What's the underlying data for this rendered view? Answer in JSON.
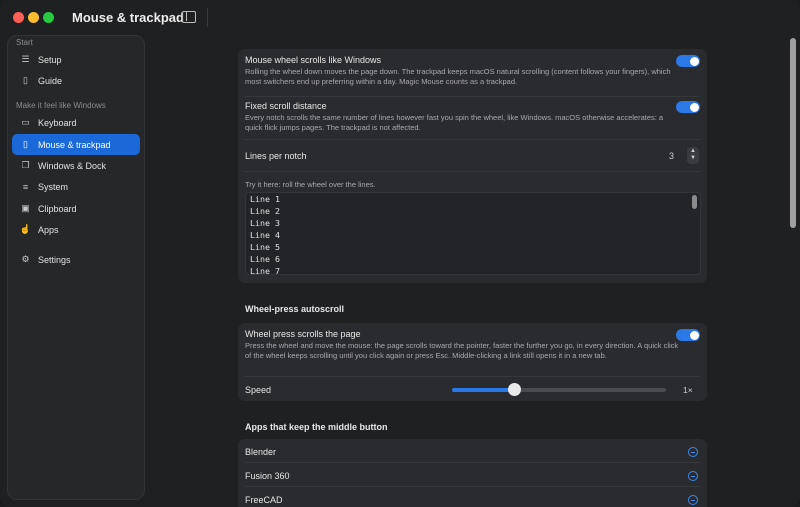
{
  "window": {
    "title": "Mouse & trackpad"
  },
  "sidebar": {
    "sections": [
      "Start",
      "Make it feel like Windows"
    ],
    "items": [
      {
        "label": "Setup",
        "icon": "checklist-icon"
      },
      {
        "label": "Guide",
        "icon": "book-icon"
      },
      {
        "label": "Keyboard",
        "icon": "keyboard-icon"
      },
      {
        "label": "Mouse & trackpad",
        "icon": "mouse-icon",
        "active": true
      },
      {
        "label": "Windows & Dock",
        "icon": "windows-icon"
      },
      {
        "label": "System",
        "icon": "sliders-icon"
      },
      {
        "label": "Clipboard",
        "icon": "clipboard-icon"
      },
      {
        "label": "Apps",
        "icon": "hand-icon"
      },
      {
        "label": "Settings",
        "icon": "gear-icon"
      }
    ]
  },
  "scroll": {
    "wheel_title": "Mouse wheel scrolls like Windows",
    "wheel_desc": "Rolling the wheel down moves the page down. The trackpad keeps macOS natural scrolling (content follows your fingers), which most switchers end up preferring within a day. Magic Mouse counts as a trackpad.",
    "wheel_on": true,
    "fixed_title": "Fixed scroll distance",
    "fixed_desc": "Every notch scrolls the same number of lines however fast you spin the wheel, like Windows. macOS otherwise accelerates: a quick flick jumps pages. The trackpad is not affected.",
    "fixed_on": true,
    "lines_label": "Lines per notch",
    "lines_value": "3",
    "try_hint": "Try it here: roll the wheel over the lines.",
    "test_lines": [
      "Line 1",
      "Line 2",
      "Line 3",
      "Line 4",
      "Line 5",
      "Line 6",
      "Line 7"
    ]
  },
  "autoscroll": {
    "section_title": "Wheel-press autoscroll",
    "title": "Wheel press scrolls the page",
    "desc": "Press the wheel and move the mouse: the page scrolls toward the pointer, faster the further you go, in every direction. A quick click of the wheel keeps scrolling until you click again or press Esc. Middle-clicking a link still opens it in a new tab.",
    "on": true,
    "speed_label": "Speed",
    "speed_value": "1×",
    "speed_fraction": 0.29
  },
  "middle_button": {
    "section_title": "Apps that keep the middle button",
    "apps": [
      "Blender",
      "Fusion 360",
      "FreeCAD"
    ]
  },
  "colors": {
    "accent": "#2a79e6",
    "active_sidebar": "#1b68d8"
  }
}
